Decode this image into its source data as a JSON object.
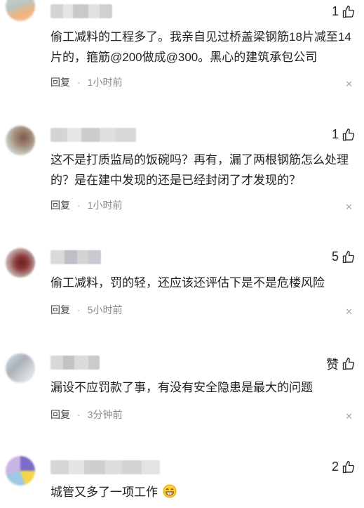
{
  "comments": [
    {
      "text": "偷工减料的工程多了。我亲自见过桥盖梁钢筋18片减至14片的，箍筋@200做成@300。黑心的建筑承包公司",
      "likes": "1",
      "reply_label": "回复",
      "time": "1小时前"
    },
    {
      "text": "这不是打质监局的饭碗吗？再有，漏了两根钢筋怎么处理的？是在建中发现的还是已经封闭了才发现的？",
      "likes": "1",
      "reply_label": "回复",
      "time": "1小时前"
    },
    {
      "text": "偷工减料，罚的轻，还应该还评估下是不是危楼风险",
      "likes": "5",
      "reply_label": "回复",
      "time": "5小时前"
    },
    {
      "text": "漏设不应罚款了事，有没有安全隐患是最大的问题",
      "likes": "赞",
      "reply_label": "回复",
      "time": "3分钟前"
    },
    {
      "text": "城管又多了一项工作",
      "likes": "2",
      "reply_label": "",
      "time": ""
    }
  ],
  "separator": "·",
  "close_glyph": "✕",
  "icons": {
    "like": "thumbs-up-icon",
    "close": "close-icon",
    "emoji": "grin-emoji-icon"
  },
  "colors": {
    "text": "#222222",
    "meta": "#888888"
  }
}
